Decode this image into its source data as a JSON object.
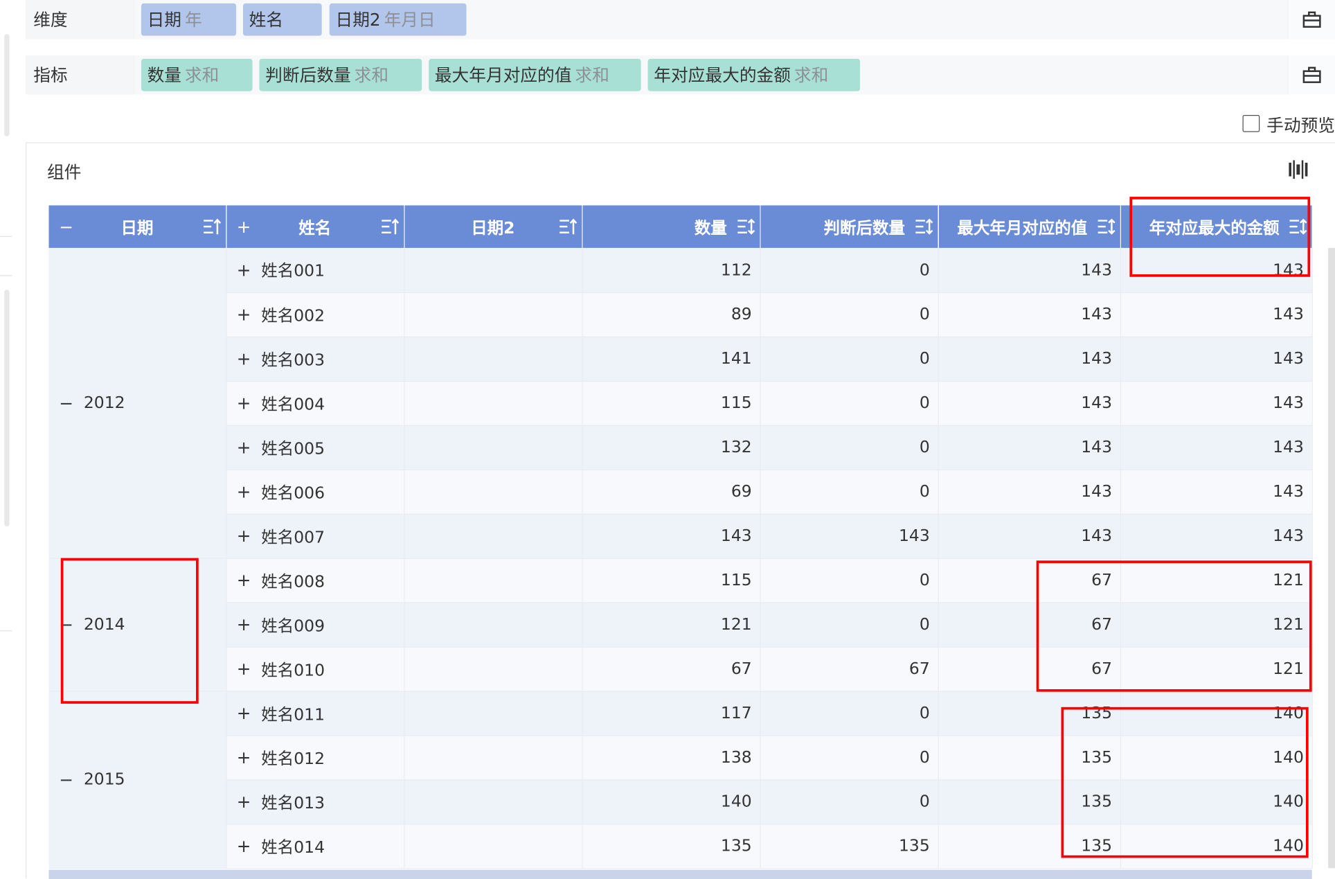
{
  "config": {
    "dimension_label": "维度",
    "dimension_chips": [
      {
        "name": "日期",
        "agg": "年"
      },
      {
        "name": "姓名",
        "agg": ""
      },
      {
        "name": "日期2",
        "agg": "年月日"
      }
    ],
    "metric_label": "指标",
    "metric_chips": [
      {
        "name": "数量",
        "agg": "求和"
      },
      {
        "name": "判断后数量",
        "agg": "求和"
      },
      {
        "name": "最大年月对应的值",
        "agg": "求和"
      },
      {
        "name": "年对应最大的金额",
        "agg": "求和"
      }
    ],
    "manual_preview_label": "手动预览",
    "manual_preview_checked": false
  },
  "panel": {
    "title": "组件",
    "columns": [
      "日期",
      "姓名",
      "日期2",
      "数量",
      "判断后数量",
      "最大年月对应的值",
      "年对应最大的金额"
    ],
    "collapse_symbol": "−",
    "expand_symbol": "+",
    "groups": [
      {
        "year": "2012",
        "rows": [
          {
            "name": "姓名001",
            "qty": "112",
            "judged": "0",
            "max_month_val": "143",
            "year_max": "143"
          },
          {
            "name": "姓名002",
            "qty": "89",
            "judged": "0",
            "max_month_val": "143",
            "year_max": "143"
          },
          {
            "name": "姓名003",
            "qty": "141",
            "judged": "0",
            "max_month_val": "143",
            "year_max": "143"
          },
          {
            "name": "姓名004",
            "qty": "115",
            "judged": "0",
            "max_month_val": "143",
            "year_max": "143"
          },
          {
            "name": "姓名005",
            "qty": "132",
            "judged": "0",
            "max_month_val": "143",
            "year_max": "143"
          },
          {
            "name": "姓名006",
            "qty": "69",
            "judged": "0",
            "max_month_val": "143",
            "year_max": "143"
          },
          {
            "name": "姓名007",
            "qty": "143",
            "judged": "143",
            "max_month_val": "143",
            "year_max": "143"
          }
        ]
      },
      {
        "year": "2014",
        "rows": [
          {
            "name": "姓名008",
            "qty": "115",
            "judged": "0",
            "max_month_val": "67",
            "year_max": "121"
          },
          {
            "name": "姓名009",
            "qty": "121",
            "judged": "0",
            "max_month_val": "67",
            "year_max": "121"
          },
          {
            "name": "姓名010",
            "qty": "67",
            "judged": "67",
            "max_month_val": "67",
            "year_max": "121"
          }
        ]
      },
      {
        "year": "2015",
        "rows": [
          {
            "name": "姓名011",
            "qty": "117",
            "judged": "0",
            "max_month_val": "135",
            "year_max": "140"
          },
          {
            "name": "姓名012",
            "qty": "138",
            "judged": "0",
            "max_month_val": "135",
            "year_max": "140"
          },
          {
            "name": "姓名013",
            "qty": "140",
            "judged": "0",
            "max_month_val": "135",
            "year_max": "140"
          },
          {
            "name": "姓名014",
            "qty": "135",
            "judged": "135",
            "max_month_val": "135",
            "year_max": "140"
          }
        ]
      }
    ]
  },
  "colors": {
    "header_bg": "#6a8bd6",
    "dimension_chip": "#b2c6ec",
    "metric_chip": "#a8e0d6",
    "highlight": "#ff0000"
  }
}
